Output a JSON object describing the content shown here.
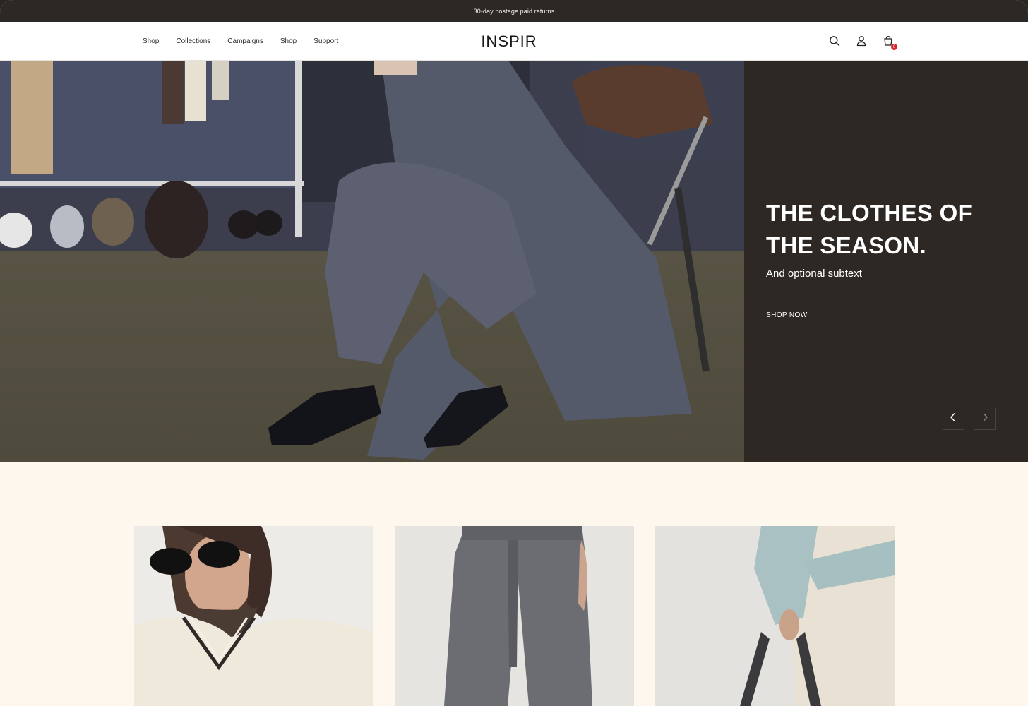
{
  "announcement": {
    "text": "30-day postage paid returns"
  },
  "header": {
    "nav": [
      "Shop",
      "Collections",
      "Campaigns",
      "Shop",
      "Support"
    ],
    "logo": "INSPIR",
    "icons": [
      "search-icon",
      "account-icon",
      "cart-icon"
    ],
    "cart_count": "0"
  },
  "hero": {
    "title_line1": "THE CLOTHES OF",
    "title_line2": "THE SEASON.",
    "subtext": "And optional subtext",
    "cta": "SHOP NOW",
    "prev_icon": "chevron-left-icon",
    "next_icon": "chevron-right-icon"
  },
  "colors": {
    "announcement_bg": "#2b2825",
    "hero_panel_bg": "#2d2824",
    "page_bg": "#fdf7ee",
    "cart_badge": "#d6242b"
  }
}
